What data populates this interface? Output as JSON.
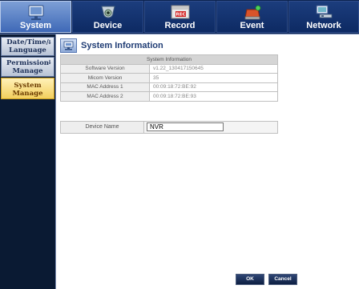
{
  "tabs": [
    {
      "label": "System",
      "icon": "monitor-icon",
      "active": true
    },
    {
      "label": "Device",
      "icon": "camera-icon",
      "active": false
    },
    {
      "label": "Record",
      "icon": "rec-icon",
      "active": false
    },
    {
      "label": "Event",
      "icon": "event-icon",
      "active": false
    },
    {
      "label": "Network",
      "icon": "network-icon",
      "active": false
    }
  ],
  "sidebar": {
    "items": [
      {
        "line1": "Date/Time/",
        "line2": "Language",
        "dropdown": true
      },
      {
        "line1": "Permission",
        "line2": "Manage",
        "dropdown": true
      },
      {
        "line1": "System",
        "line2": "Manage",
        "dropdown": false,
        "active": true
      }
    ]
  },
  "page": {
    "title": "System Information",
    "icon": "system-info-icon"
  },
  "info_table": {
    "header": "System Information",
    "rows": [
      {
        "key": "Software Version",
        "value": "v1.22_130417150645"
      },
      {
        "key": "Micom Version",
        "value": "35"
      },
      {
        "key": "MAC Address 1",
        "value": "00:09:18:72:BE:92"
      },
      {
        "key": "MAC Address 2",
        "value": "00:09:18:72:BE:93"
      }
    ]
  },
  "device_name": {
    "label": "Device Name",
    "value": "NVR"
  },
  "buttons": {
    "ok": "OK",
    "cancel": "Cancel"
  }
}
